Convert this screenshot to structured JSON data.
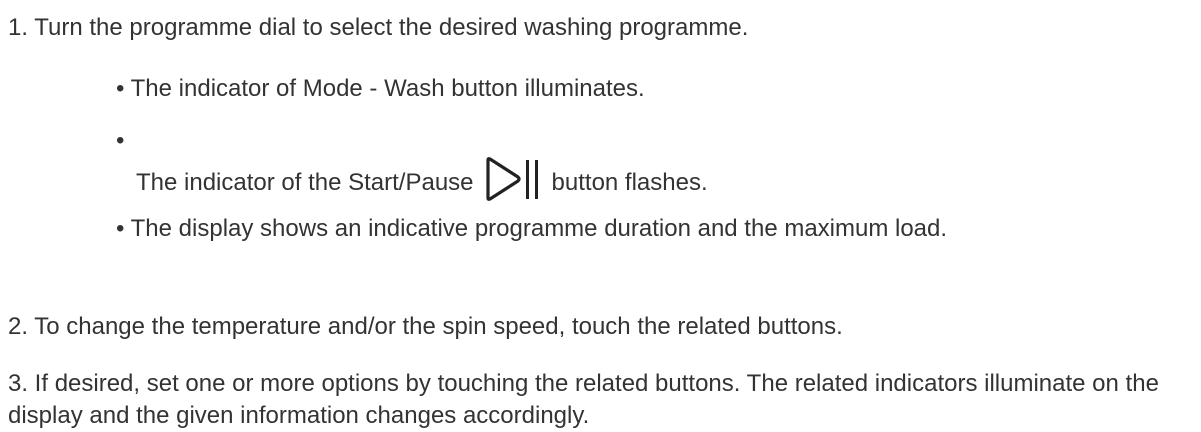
{
  "steps": [
    {
      "text": "1. Turn the programme dial to select the desired washing programme."
    },
    {
      "text": "2. To change the temperature and/or the spin speed, touch the related buttons."
    },
    {
      "text": "3. If desired, set one or more options by touching the related buttons. The related indicators illuminate on the display and the given information changes accordingly."
    }
  ],
  "bullets": [
    {
      "text": "• The indicator of Mode - Wash button illuminates."
    },
    {
      "dot": "•",
      "before_icon": "The indicator of the Start/Pause",
      "icon": "start-pause-icon",
      "after_icon": "button flashes."
    },
    {
      "text": "• The display shows an indicative programme duration and the maximum load."
    }
  ],
  "colors": {
    "text": "#333333",
    "icon": "#222222"
  }
}
